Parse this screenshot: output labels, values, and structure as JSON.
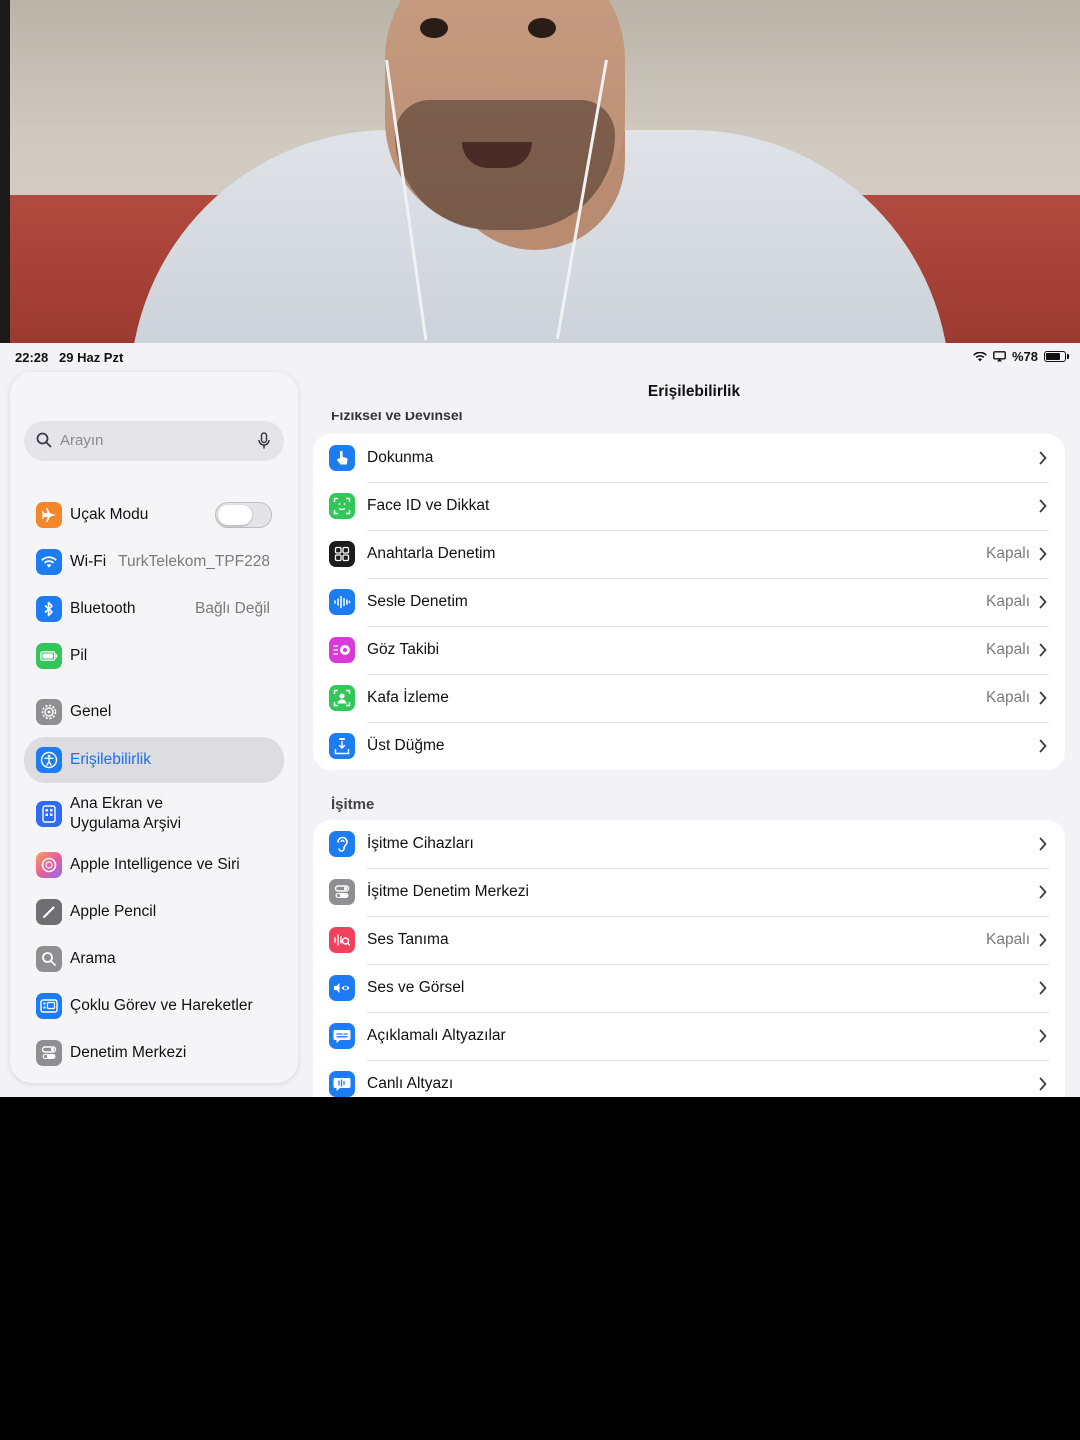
{
  "status": {
    "time": "22:28",
    "date": "29 Haz Pzt",
    "battery": "%78"
  },
  "sidebar": {
    "search_placeholder": "Arayın",
    "items": [
      {
        "label": "Uçak Modu",
        "icon": "airplane-icon",
        "color": "#f5862a",
        "toggle": false
      },
      {
        "label": "Wi-Fi",
        "value": "TurkTelekom_TPF228",
        "icon": "wifi-icon",
        "color": "#1d7cf2"
      },
      {
        "label": "Bluetooth",
        "value": "Bağlı Değil",
        "icon": "bluetooth-icon",
        "color": "#1d7cf2"
      },
      {
        "label": "Pil",
        "icon": "battery-icon",
        "color": "#33c759"
      },
      {
        "label": "Genel",
        "icon": "gear-icon",
        "color": "#8e8e93"
      },
      {
        "label": "Erişilebilirlik",
        "icon": "accessibility-icon",
        "color": "#1d7cf2",
        "selected": true
      },
      {
        "label": "Ana Ekran ve",
        "label2": "Uygulama Arşivi",
        "icon": "home-screen-icon",
        "color": "#2e6cf5"
      },
      {
        "label": "Apple Intelligence ve Siri",
        "icon": "siri-icon",
        "color": "#e85d9a"
      },
      {
        "label": "Apple Pencil",
        "icon": "pencil-icon",
        "color": "#6e6e73"
      },
      {
        "label": "Arama",
        "icon": "search-icon",
        "color": "#8e8e93"
      },
      {
        "label": "Çoklu Görev ve Hareketler",
        "icon": "multitasking-icon",
        "color": "#1d7cf2"
      },
      {
        "label": "Denetim Merkezi",
        "icon": "control-center-icon",
        "color": "#8e8e93"
      }
    ]
  },
  "detail": {
    "title": "Erişilebilirlik",
    "section_cut": "Fiziksel ve Devinsel",
    "physical": [
      {
        "label": "Dokunma",
        "icon": "touch-icon",
        "color": "#1d7cf2"
      },
      {
        "label": "Face ID ve Dikkat",
        "icon": "face-id-icon",
        "color": "#33c759"
      },
      {
        "label": "Anahtarla Denetim",
        "value": "Kapalı",
        "icon": "switch-control-icon",
        "color": "#1c1c1e"
      },
      {
        "label": "Sesle Denetim",
        "value": "Kapalı",
        "icon": "voice-control-icon",
        "color": "#1d7cf2"
      },
      {
        "label": "Göz Takibi",
        "value": "Kapalı",
        "icon": "eye-tracking-icon",
        "color": "#d63ad8"
      },
      {
        "label": "Kafa İzleme",
        "value": "Kapalı",
        "icon": "head-tracking-icon",
        "color": "#33c759"
      },
      {
        "label": "Üst Düğme",
        "icon": "top-button-icon",
        "color": "#1d7cf2"
      }
    ],
    "hearing_header": "İşitme",
    "hearing": [
      {
        "label": "İşitme Cihazları",
        "icon": "ear-icon",
        "color": "#1d7cf2"
      },
      {
        "label": "İşitme Denetim Merkezi",
        "icon": "hearing-control-icon",
        "color": "#8e8e93"
      },
      {
        "label": "Ses Tanıma",
        "value": "Kapalı",
        "icon": "sound-recognition-icon",
        "color": "#f0415d"
      },
      {
        "label": "Ses ve Görsel",
        "icon": "audio-visual-icon",
        "color": "#1d7cf2"
      },
      {
        "label": "Açıklamalı Altyazılar",
        "icon": "subtitles-icon",
        "color": "#1d7cf2"
      },
      {
        "label": "Canlı Altyazı",
        "icon": "live-captions-icon",
        "color": "#1d7cf2"
      }
    ]
  }
}
